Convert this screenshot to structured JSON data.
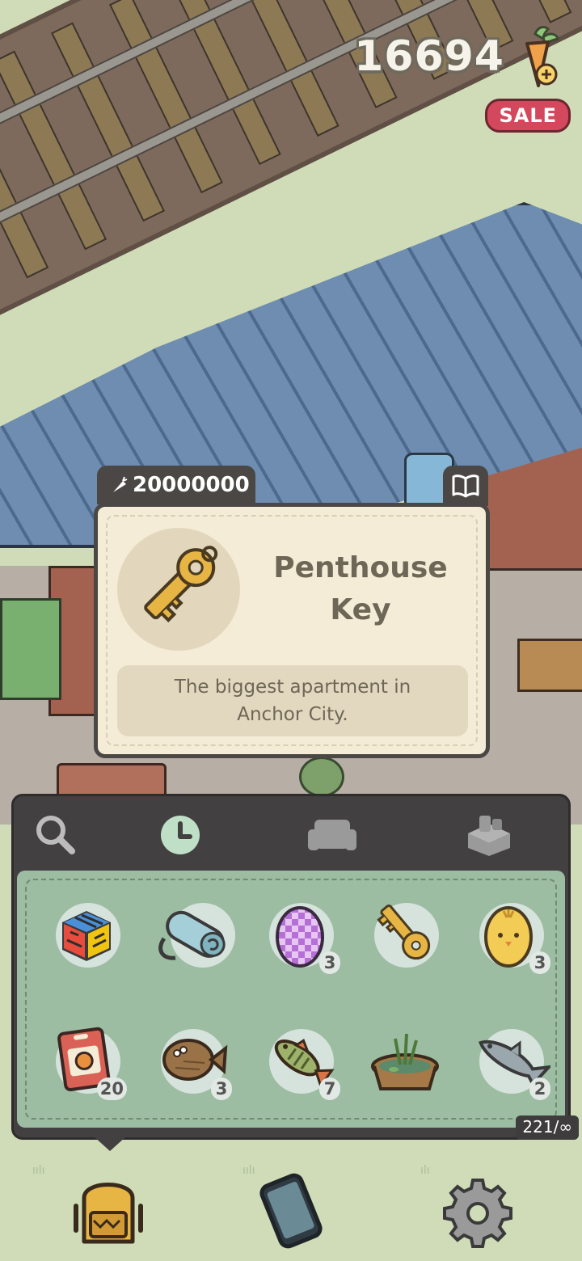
{
  "currency": {
    "amount": "16694",
    "icon": "carrot-plus-icon",
    "sale_label": "SALE"
  },
  "item_detail": {
    "price": "20000000",
    "price_icon": "carrot-small-icon",
    "name": "Penthouse Key",
    "description": "The biggest apartment in Anchor City.",
    "book_icon": "book-icon"
  },
  "inventory": {
    "tabs": [
      {
        "name": "search",
        "icon": "magnifier-icon",
        "active": false
      },
      {
        "name": "recent",
        "icon": "clock-icon",
        "active": true
      },
      {
        "name": "furniture",
        "icon": "sofa-icon",
        "active": false
      },
      {
        "name": "items",
        "icon": "box-icon",
        "active": false
      }
    ],
    "items": [
      {
        "name": "rubiks-cube",
        "count": ""
      },
      {
        "name": "sleeping-mat",
        "count": ""
      },
      {
        "name": "purple-egg",
        "count": "3"
      },
      {
        "name": "penthouse-key",
        "count": ""
      },
      {
        "name": "chick-egg",
        "count": "3"
      },
      {
        "name": "seed-packet",
        "count": "20"
      },
      {
        "name": "flounder",
        "count": "3"
      },
      {
        "name": "perch",
        "count": "7"
      },
      {
        "name": "planter-pot",
        "count": ""
      },
      {
        "name": "shark",
        "count": "2"
      }
    ],
    "capacity": "221/∞"
  },
  "bottom_nav": [
    {
      "name": "backpack",
      "icon": "backpack-icon"
    },
    {
      "name": "phone",
      "icon": "phone-icon"
    },
    {
      "name": "settings",
      "icon": "gear-icon"
    }
  ],
  "colors": {
    "panel": "#424040",
    "grid_bg": "#9cbda2",
    "card_bg": "#f4ecd6",
    "active_tab": "#bfe0c6",
    "sale": "#d3485c"
  }
}
